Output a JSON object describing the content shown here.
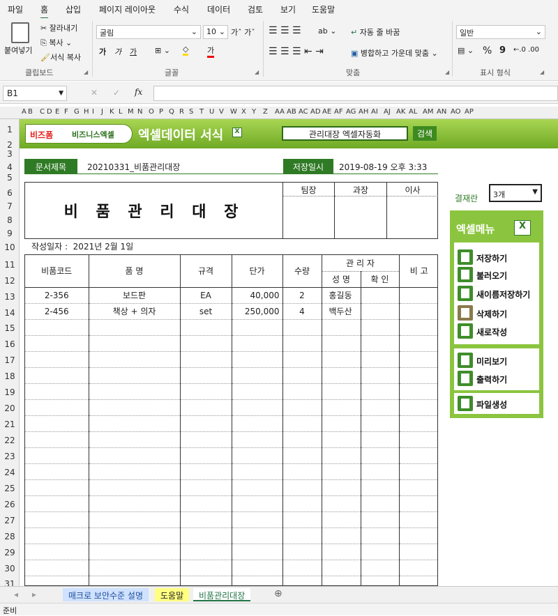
{
  "menubar": {
    "tabs": [
      "파일",
      "홈",
      "삽입",
      "페이지 레이아웃",
      "수식",
      "데이터",
      "검토",
      "보기",
      "도움말"
    ]
  },
  "ribbon": {
    "clipboard": {
      "paste": "붙여넣기",
      "cut": "잘라내기",
      "copy": "복사",
      "format_painter": "서식 복사",
      "label": "클립보드"
    },
    "font": {
      "name": "굴림",
      "size": "10",
      "bold": "가",
      "italic": "가",
      "underline": "가",
      "label": "글꼴"
    },
    "align": {
      "wrap": "자동 줄 바꿈",
      "merge": "병합하고 가운데 맞춤",
      "label": "맞춤"
    },
    "number": {
      "format": "일반",
      "percent": "%",
      "comma": "9",
      "label": "표시 형식"
    }
  },
  "formulabar": {
    "namebox": "B1",
    "fx": "fx",
    "cancel": "✕",
    "enter": "✓"
  },
  "columns": [
    "A",
    "B",
    "C",
    "D",
    "E",
    "F",
    "G",
    "H",
    "I",
    "J",
    "K",
    "L",
    "M",
    "N",
    "O",
    "P",
    "Q",
    "R",
    "S",
    "T",
    "U",
    "V",
    "W",
    "X",
    "Y",
    "Z",
    "AA",
    "AB",
    "AC",
    "AD",
    "AE",
    "AF",
    "AG",
    "AH",
    "AI",
    "AJ",
    "AK",
    "AL",
    "AM",
    "AN",
    "AO",
    "AP"
  ],
  "rows": [
    "1",
    "2",
    "3",
    "4",
    "5",
    "6",
    "7",
    "8",
    "9",
    "10",
    "11",
    "12",
    "13",
    "14",
    "15",
    "16",
    "17",
    "18",
    "19",
    "20",
    "21",
    "22",
    "23",
    "24",
    "25",
    "26",
    "27",
    "28",
    "29",
    "30",
    "31"
  ],
  "banner": {
    "logo1": "비즈폼",
    "logo2": "비즈니스엑셀",
    "title": "엑셀데이터 서식",
    "search_value": "관리대장 엑셀자동화",
    "search_button": "검색"
  },
  "doc": {
    "title_label": "문서제목",
    "title_value": "20210331_비품관리대장",
    "saved_label": "저장일시",
    "saved_value": "2019-08-19  오후 3:33"
  },
  "form": {
    "main_title": "비 품 관 리 대 장",
    "approvers": [
      "팀장",
      "과장",
      "이사"
    ],
    "date_label": "작성일자 :",
    "date_value": "2021년  2월  1일",
    "headers": {
      "code": "비품코드",
      "name": "품  명",
      "spec": "규격",
      "price": "단가",
      "qty": "수량",
      "manager": "관 리 자",
      "mgr_name": "성 명",
      "mgr_check": "확 인",
      "note": "비 고"
    },
    "items": [
      {
        "code": "2-356",
        "name": "보드판",
        "spec": "EA",
        "price": "40,000",
        "qty": "2",
        "mgr": "홍길동",
        "check": "",
        "note": ""
      },
      {
        "code": "2-456",
        "name": "책상 + 의자",
        "spec": "set",
        "price": "250,000",
        "qty": "4",
        "mgr": "백두산",
        "check": "",
        "note": ""
      }
    ]
  },
  "side": {
    "approval_label": "결재란",
    "approval_value": "3개",
    "menu_title": "엑셀메뉴",
    "group1": [
      "저장하기",
      "불러오기",
      "새이름저장하기",
      "삭제하기",
      "새로작성"
    ],
    "group2": [
      "미리보기",
      "출력하기"
    ],
    "group3": [
      "파일생성"
    ]
  },
  "sheets": {
    "tabs": [
      "매크로 보안수준 설명",
      "도움말",
      "비품관리대장"
    ],
    "active": "비품관리대장"
  },
  "status": {
    "text": "준비"
  },
  "colors": {
    "accent": "#217346",
    "banner": "#8bc53f",
    "dark_green": "#2f7a25"
  }
}
